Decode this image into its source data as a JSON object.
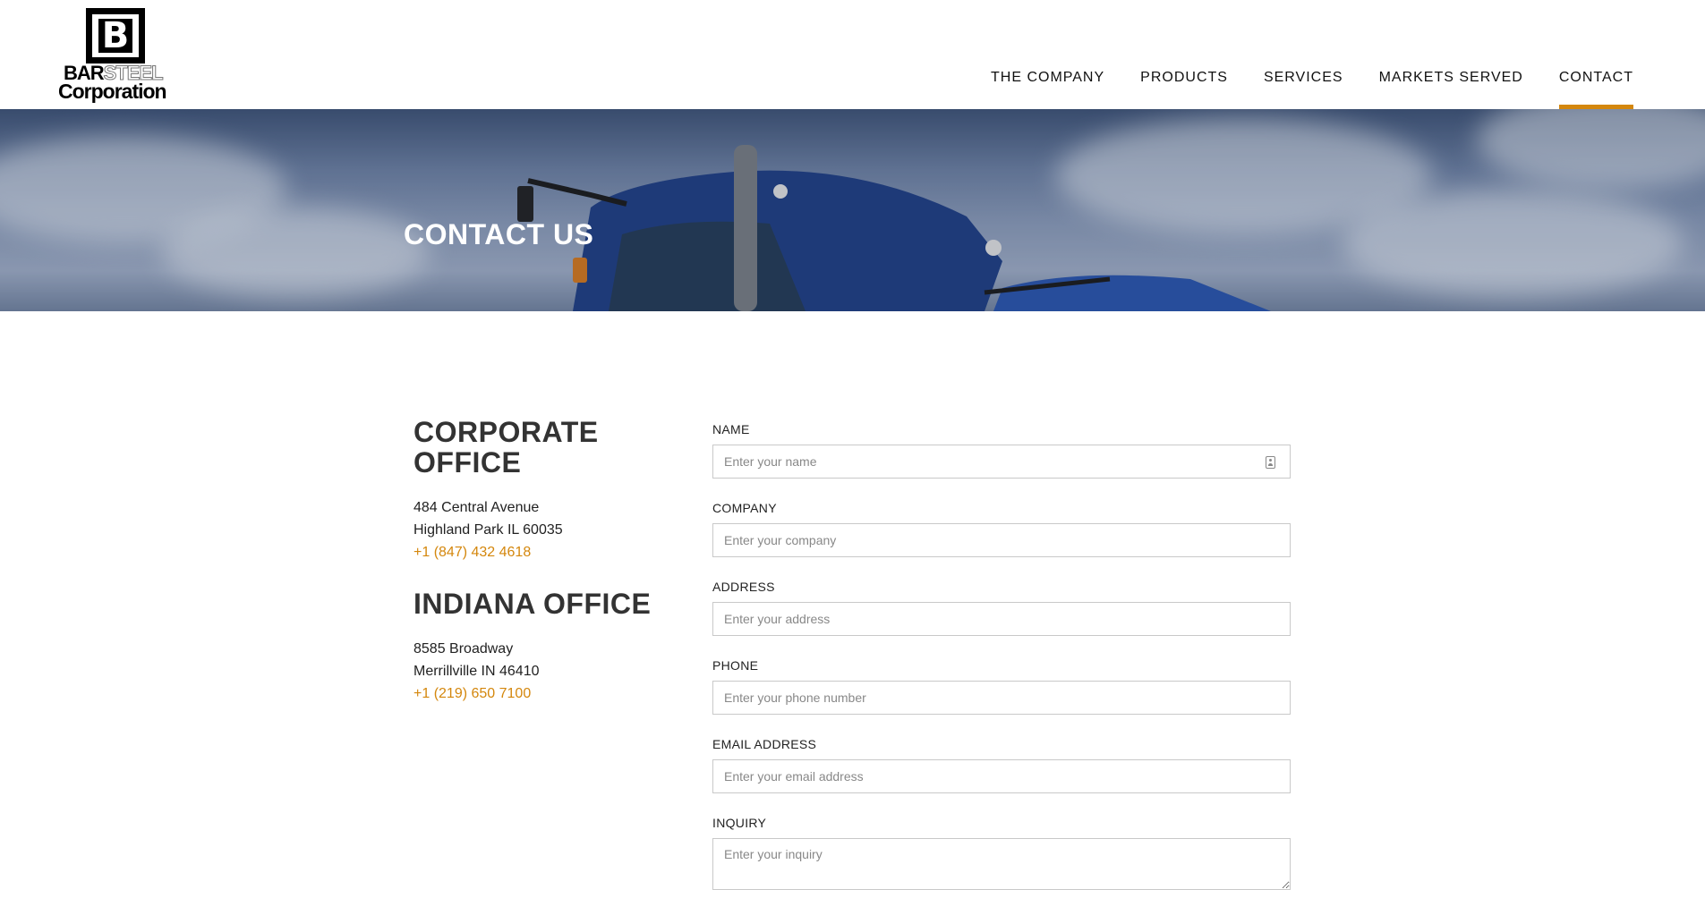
{
  "brand": {
    "logo_letter": "B",
    "logo_bar": "BAR",
    "logo_steel": "STEEL",
    "logo_corporation": "Corporation"
  },
  "nav": {
    "items": [
      {
        "label": "THE COMPANY",
        "active": false
      },
      {
        "label": "PRODUCTS",
        "active": false
      },
      {
        "label": "SERVICES",
        "active": false
      },
      {
        "label": "MARKETS SERVED",
        "active": false
      },
      {
        "label": "CONTACT",
        "active": true
      }
    ]
  },
  "hero": {
    "title": "CONTACT US"
  },
  "offices": {
    "corporate": {
      "heading": "CORPORATE OFFICE",
      "address_line1": "484 Central Avenue",
      "address_line2": "Highland Park IL 60035",
      "phone": "+1 (847) 432 4618"
    },
    "indiana": {
      "heading": "INDIANA OFFICE",
      "address_line1": "8585 Broadway",
      "address_line2": "Merrillville IN 46410",
      "phone": "+1 (219) 650 7100"
    }
  },
  "form": {
    "name": {
      "label": "NAME",
      "placeholder": "Enter your name",
      "value": ""
    },
    "company": {
      "label": "COMPANY",
      "placeholder": "Enter your company",
      "value": ""
    },
    "address": {
      "label": "ADDRESS",
      "placeholder": "Enter your address",
      "value": ""
    },
    "phone": {
      "label": "PHONE",
      "placeholder": "Enter your phone number",
      "value": ""
    },
    "email": {
      "label": "EMAIL ADDRESS",
      "placeholder": "Enter your email address",
      "value": ""
    },
    "inquiry": {
      "label": "INQUIRY",
      "placeholder": "Enter your inquiry",
      "value": ""
    }
  },
  "colors": {
    "accent": "#d4870d",
    "text": "#222222",
    "heading": "#333333"
  },
  "icons": {
    "name_field_icon": "contact-card-icon"
  }
}
